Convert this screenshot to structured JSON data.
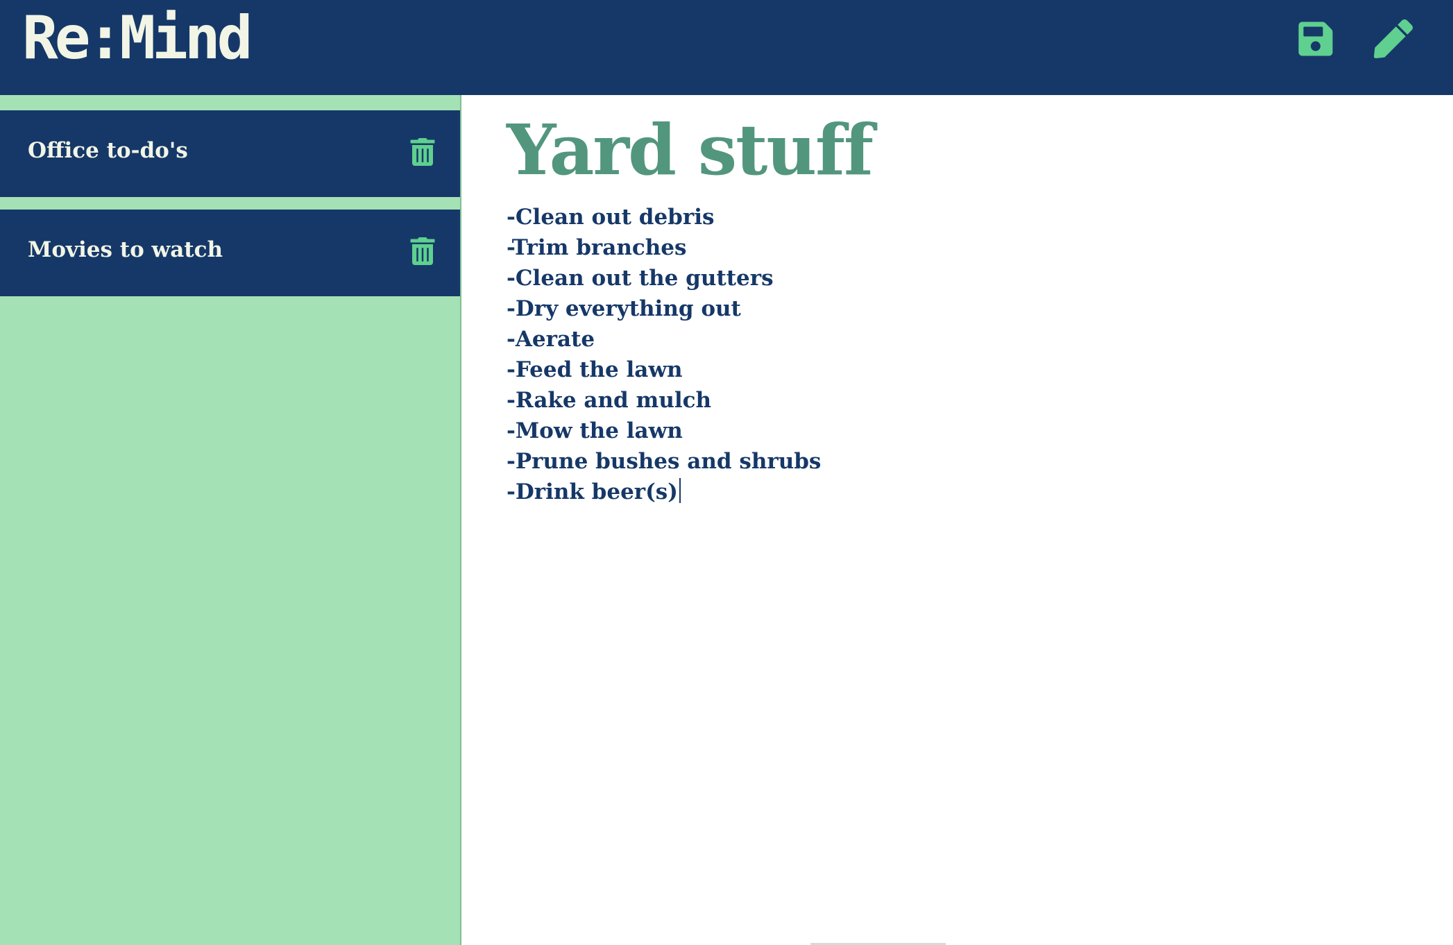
{
  "app": {
    "title": "Re:Mind"
  },
  "toolbar": {
    "save_icon": "save-icon",
    "edit_icon": "pencil-icon"
  },
  "sidebar": {
    "items": [
      {
        "label": "Office to-do's",
        "delete_icon": "trash-icon"
      },
      {
        "label": "Movies to watch",
        "delete_icon": "trash-icon"
      }
    ]
  },
  "editor": {
    "title": "Yard stuff",
    "lines": [
      "-Clean out debris",
      "-Trim branches",
      "-Clean out the gutters",
      "-Dry everything out",
      "-Aerate",
      "-Feed the lawn",
      "-Rake and mulch",
      "-Mow the lawn",
      "-Prune bushes and shrubs",
      "-Drink beer(s)"
    ]
  },
  "colors": {
    "navy": "#163868",
    "mint": "#a4e2b5",
    "accent_green": "#52967e",
    "icon_green": "#5fd08f",
    "cream": "#f2f5e6"
  }
}
